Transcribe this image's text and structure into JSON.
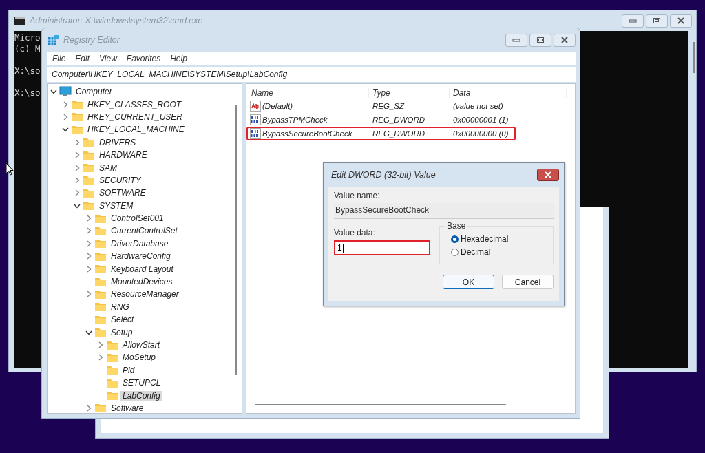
{
  "console_window": {
    "title": "Administrator: X:\\windows\\system32\\cmd.exe",
    "lines": [
      "Micro",
      "(c) M",
      "X:\\so",
      "X:\\so"
    ]
  },
  "registry_editor": {
    "title": "Registry Editor",
    "menu": [
      "File",
      "Edit",
      "View",
      "Favorites",
      "Help"
    ],
    "address": "Computer\\HKEY_LOCAL_MACHINE\\SYSTEM\\Setup\\LabConfig",
    "tree": [
      {
        "label": "Computer",
        "kind": "computer",
        "expandable": true,
        "expanded": true,
        "selected": false,
        "children": [
          {
            "label": "HKEY_CLASSES_ROOT",
            "kind": "folder",
            "expandable": true,
            "expanded": false,
            "selected": false
          },
          {
            "label": "HKEY_CURRENT_USER",
            "kind": "folder",
            "expandable": true,
            "expanded": false,
            "selected": false
          },
          {
            "label": "HKEY_LOCAL_MACHINE",
            "kind": "folder",
            "expandable": true,
            "expanded": true,
            "selected": false,
            "children": [
              {
                "label": "DRIVERS",
                "kind": "folder",
                "expandable": true,
                "expanded": false,
                "selected": false
              },
              {
                "label": "HARDWARE",
                "kind": "folder",
                "expandable": true,
                "expanded": false,
                "selected": false
              },
              {
                "label": "SAM",
                "kind": "folder",
                "expandable": true,
                "expanded": false,
                "selected": false
              },
              {
                "label": "SECURITY",
                "kind": "folder",
                "expandable": true,
                "expanded": false,
                "selected": false
              },
              {
                "label": "SOFTWARE",
                "kind": "folder",
                "expandable": true,
                "expanded": false,
                "selected": false
              },
              {
                "label": "SYSTEM",
                "kind": "folder",
                "expandable": true,
                "expanded": true,
                "selected": false,
                "children": [
                  {
                    "label": "ControlSet001",
                    "kind": "folder",
                    "expandable": true,
                    "expanded": false,
                    "selected": false
                  },
                  {
                    "label": "CurrentControlSet",
                    "kind": "folder",
                    "expandable": true,
                    "expanded": false,
                    "selected": false
                  },
                  {
                    "label": "DriverDatabase",
                    "kind": "folder",
                    "expandable": true,
                    "expanded": false,
                    "selected": false
                  },
                  {
                    "label": "HardwareConfig",
                    "kind": "folder",
                    "expandable": true,
                    "expanded": false,
                    "selected": false
                  },
                  {
                    "label": "Keyboard Layout",
                    "kind": "folder",
                    "expandable": true,
                    "expanded": false,
                    "selected": false
                  },
                  {
                    "label": "MountedDevices",
                    "kind": "folder",
                    "expandable": false,
                    "expanded": false,
                    "selected": false
                  },
                  {
                    "label": "ResourceManager",
                    "kind": "folder",
                    "expandable": true,
                    "expanded": false,
                    "selected": false
                  },
                  {
                    "label": "RNG",
                    "kind": "folder",
                    "expandable": false,
                    "expanded": false,
                    "selected": false
                  },
                  {
                    "label": "Select",
                    "kind": "folder",
                    "expandable": false,
                    "expanded": false,
                    "selected": false
                  },
                  {
                    "label": "Setup",
                    "kind": "folder",
                    "expandable": true,
                    "expanded": true,
                    "selected": false,
                    "children": [
                      {
                        "label": "AllowStart",
                        "kind": "folder",
                        "expandable": true,
                        "expanded": false,
                        "selected": false
                      },
                      {
                        "label": "MoSetup",
                        "kind": "folder",
                        "expandable": true,
                        "expanded": false,
                        "selected": false
                      },
                      {
                        "label": "Pid",
                        "kind": "folder",
                        "expandable": false,
                        "expanded": false,
                        "selected": false
                      },
                      {
                        "label": "SETUPCL",
                        "kind": "folder",
                        "expandable": false,
                        "expanded": false,
                        "selected": false
                      },
                      {
                        "label": "LabConfig",
                        "kind": "folder",
                        "expandable": false,
                        "expanded": false,
                        "selected": true
                      }
                    ]
                  },
                  {
                    "label": "Software",
                    "kind": "folder",
                    "expandable": true,
                    "expanded": false,
                    "selected": false
                  }
                ]
              }
            ]
          }
        ]
      }
    ],
    "columns": [
      "Name",
      "Type",
      "Data"
    ],
    "values": [
      {
        "kind": "string",
        "name": "(Default)",
        "type": "REG_SZ",
        "data": "(value not set)",
        "highlighted": false
      },
      {
        "kind": "dword",
        "name": "BypassTPMCheck",
        "type": "REG_DWORD",
        "data": "0x00000001 (1)",
        "highlighted": false
      },
      {
        "kind": "dword",
        "name": "BypassSecureBootCheck",
        "type": "REG_DWORD",
        "data": "0x00000000 (0)",
        "highlighted": true
      }
    ]
  },
  "dialog": {
    "title": "Edit DWORD (32-bit) Value",
    "value_name_label": "Value name:",
    "value_name": "BypassSecureBootCheck",
    "value_data_label": "Value data:",
    "value_data": "1",
    "value_data_highlighted": true,
    "base": {
      "label": "Base",
      "options": [
        {
          "label": "Hexadecimal",
          "selected": true
        },
        {
          "label": "Decimal",
          "selected": false
        }
      ]
    },
    "buttons": [
      {
        "label": "OK",
        "default": true
      },
      {
        "label": "Cancel",
        "default": false
      }
    ]
  }
}
